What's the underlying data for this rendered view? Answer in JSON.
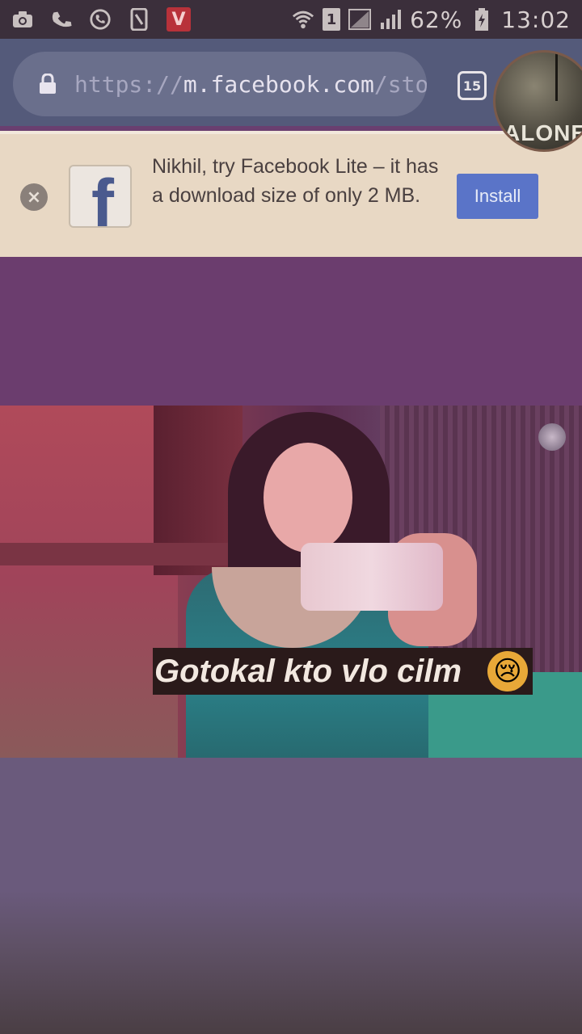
{
  "status_bar": {
    "battery_percent": "62%",
    "time": "13:02",
    "sim_slot": "1",
    "left_icons": [
      "camera-icon",
      "phone-icon",
      "whatsapp-icon",
      "screenshot-icon",
      "vidmate-icon"
    ],
    "vidmate_label": "V"
  },
  "browser": {
    "url_prefix": "https://",
    "url_host": "m.facebook.com",
    "url_path": "/storie",
    "tab_count": "15"
  },
  "profile": {
    "avatar_text": "ALONE"
  },
  "banner": {
    "message": "Nikhil, try Facebook Lite – it has a download size of only 2 MB.",
    "install_label": "Install",
    "close_label": "×",
    "logo_letter": "f"
  },
  "story": {
    "caption": "Gotokal kto vlo cilm",
    "caption_emoji": "😢"
  },
  "colors": {
    "status_bar_bg": "#3b2f3b",
    "url_bar_bg": "#545a7a",
    "banner_bg": "#e8d8c4",
    "install_button": "#5a74c8",
    "story_bg": "#6b3d6e"
  }
}
